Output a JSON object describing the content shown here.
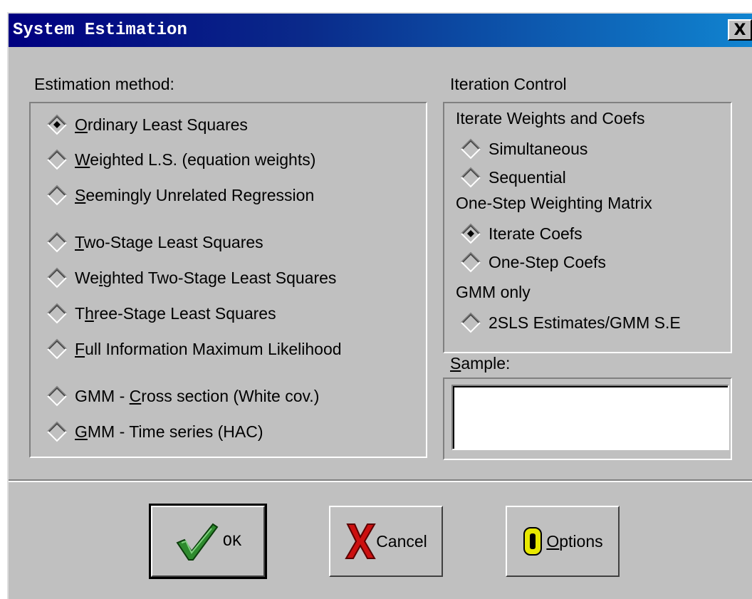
{
  "window": {
    "title": "System Estimation",
    "close_glyph": "X"
  },
  "estimation": {
    "label": "Estimation method:",
    "options": [
      {
        "pre": "",
        "u": "O",
        "post": "rdinary Least Squares",
        "selected": true
      },
      {
        "pre": "",
        "u": "W",
        "post": "eighted L.S.  (equation weights)",
        "selected": false
      },
      {
        "pre": "",
        "u": "S",
        "post": "eemingly Unrelated Regression",
        "selected": false
      },
      {
        "pre": "",
        "u": "T",
        "post": "wo-Stage Least Squares",
        "selected": false
      },
      {
        "pre": "We",
        "u": "i",
        "post": "ghted Two-Stage Least Squares",
        "selected": false
      },
      {
        "pre": "T",
        "u": "h",
        "post": "ree-Stage Least Squares",
        "selected": false
      },
      {
        "pre": "",
        "u": "F",
        "post": "ull Information Maximum Likelihood",
        "selected": false
      },
      {
        "pre": "GMM - ",
        "u": "C",
        "post": "ross section (White cov.)",
        "selected": false
      },
      {
        "pre": "",
        "u": "G",
        "post": "MM - Time series    (HAC)",
        "selected": false
      }
    ]
  },
  "iteration": {
    "label": "Iteration Control",
    "group1_label": "Iterate Weights and Coefs",
    "group1_options": [
      {
        "text": "Simultaneous",
        "selected": false
      },
      {
        "text": "Sequential",
        "selected": false
      }
    ],
    "group2_label": "One-Step Weighting Matrix",
    "group2_options": [
      {
        "text": "Iterate Coefs",
        "selected": true
      },
      {
        "text": "One-Step Coefs",
        "selected": false
      }
    ],
    "group3_label": "GMM only",
    "group3_options": [
      {
        "text": "2SLS Estimates/GMM S.E",
        "selected": false
      }
    ]
  },
  "sample": {
    "label_u": "S",
    "label_rest": "ample:",
    "value": ""
  },
  "buttons": {
    "ok": {
      "label": "OK",
      "icon": "checkmark-icon",
      "color": "#2e8b2e"
    },
    "cancel": {
      "label": "Cancel",
      "icon": "x-icon",
      "color": "#cc1010"
    },
    "options": {
      "pre": "",
      "u": "O",
      "post": "ptions",
      "icon": "o-icon",
      "color": "#e8e800"
    }
  }
}
